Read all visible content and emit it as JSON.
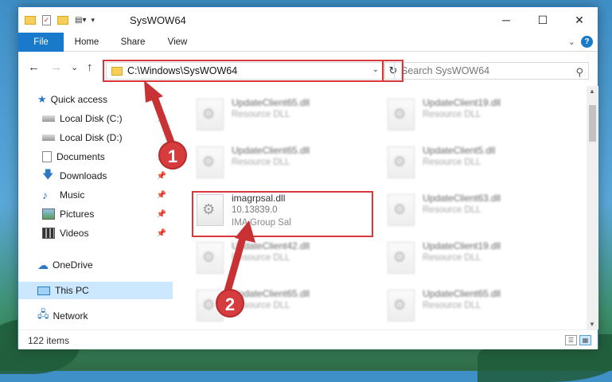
{
  "window": {
    "title": "SysWOW64",
    "minimize_glyph": "─",
    "maximize_glyph": "☐",
    "close_glyph": "✕"
  },
  "ribbon": {
    "tabs": [
      "File",
      "Home",
      "Share",
      "View"
    ],
    "help": "?"
  },
  "navigation": {
    "back": "←",
    "forward": "→",
    "recent": "⌄",
    "up": "↑",
    "address": "C:\\Windows\\SysWOW64",
    "refresh": "↻",
    "search_placeholder": "Search SysWOW64"
  },
  "sidebar": {
    "items": [
      {
        "label": "Quick access",
        "icon": "star-icon",
        "pinned": false
      },
      {
        "label": "Local Disk (C:)",
        "icon": "drive-icon",
        "pinned": true
      },
      {
        "label": "Local Disk (D:)",
        "icon": "drive-icon",
        "pinned": false
      },
      {
        "label": "Documents",
        "icon": "documents-icon",
        "pinned": true
      },
      {
        "label": "Downloads",
        "icon": "downloads-icon",
        "pinned": true
      },
      {
        "label": "Music",
        "icon": "music-icon",
        "pinned": true
      },
      {
        "label": "Pictures",
        "icon": "pictures-icon",
        "pinned": true
      },
      {
        "label": "Videos",
        "icon": "videos-icon",
        "pinned": true
      },
      {
        "label": "OneDrive",
        "icon": "onedrive-icon",
        "pinned": false
      },
      {
        "label": "This PC",
        "icon": "computer-icon",
        "pinned": false,
        "selected": true
      },
      {
        "label": "Network",
        "icon": "network-icon",
        "pinned": false
      }
    ]
  },
  "files": {
    "blurred_left": [
      {
        "name": "UpdateClient65.dll",
        "desc": "Resource DLL"
      },
      {
        "name": "UpdateClient65.dll",
        "desc": "Resource DLL"
      },
      {
        "name": "UpdateClient42.dll",
        "desc": "Resource DLL"
      },
      {
        "name": "UpdateClient65.dll",
        "desc": "Resource DLL"
      }
    ],
    "blurred_right": [
      {
        "name": "UpdateClient19.dll",
        "desc": "Resource DLL"
      },
      {
        "name": "UpdateClient5.dll",
        "desc": "Resource DLL"
      },
      {
        "name": "UpdateClient63.dll",
        "desc": "Resource DLL"
      },
      {
        "name": "UpdateClient19.dll",
        "desc": "Resource DLL"
      },
      {
        "name": "UpdateClient65.dll",
        "desc": "Resource DLL"
      }
    ],
    "highlighted": {
      "name": "imagrpsal.dll",
      "version": "10.13839.0",
      "company": "IMA Group Sal"
    }
  },
  "status": {
    "items": "122 items"
  },
  "annotations": {
    "step1": "1",
    "step2": "2",
    "color": "#d9383a"
  }
}
